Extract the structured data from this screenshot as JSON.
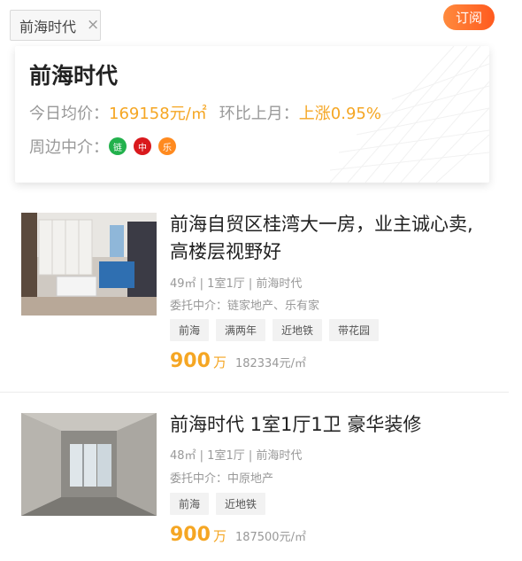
{
  "filter_tag": {
    "label": "前海时代",
    "close_glyph": "×"
  },
  "subscribe_label": "订阅",
  "community": {
    "name": "前海时代",
    "avg_price_label": "今日均价：",
    "avg_price_value": "169158元/㎡",
    "mom_label": "环比上月：",
    "mom_value": "上涨0.95%",
    "agents_label": "周边中介：",
    "agents": [
      {
        "label": "链",
        "color": "#22b14c"
      },
      {
        "label": "中",
        "color": "#d9191d"
      },
      {
        "label": "乐",
        "color": "#ff8a1f"
      }
    ]
  },
  "listings": [
    {
      "title": "前海自贸区桂湾大一房，业主诚心卖,高楼层视野好",
      "meta": "49㎡ | 1室1厅 | 前海时代",
      "agency": "委托中介：链家地产、乐有家",
      "tags": [
        "前海",
        "满两年",
        "近地铁",
        "带花园"
      ],
      "total_price": "900",
      "total_unit": "万",
      "unit_price": "182334元/㎡"
    },
    {
      "title": "前海时代 1室1厅1卫 豪华装修",
      "meta": "48㎡ | 1室1厅 | 前海时代",
      "agency": "委托中介：中原地产",
      "tags": [
        "前海",
        "近地铁"
      ],
      "total_price": "900",
      "total_unit": "万",
      "unit_price": "187500元/㎡"
    }
  ]
}
